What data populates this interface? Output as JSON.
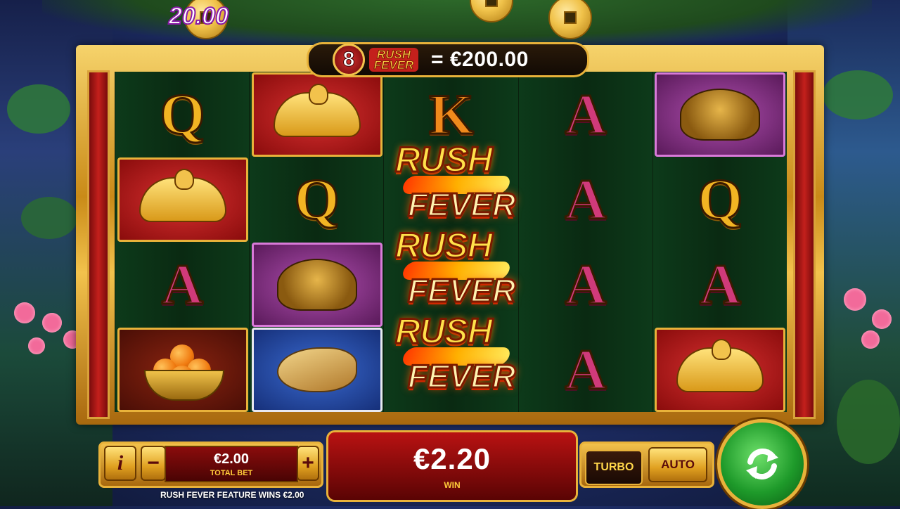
{
  "coin_value": "20.00",
  "top_bar": {
    "multiplier": "8",
    "feature_logo_line1": "RUSH",
    "feature_logo_line2": "FEVER",
    "prize_text": "= €200.00"
  },
  "reels": [
    [
      "Q",
      "bat",
      "A",
      "orange"
    ],
    [
      "bat",
      "Q",
      "frog",
      "bird"
    ],
    [
      "K",
      "rush-fever",
      "rush-fever",
      "rush-fever"
    ],
    [
      "A",
      "A",
      "A",
      "A"
    ],
    [
      "frog",
      "Q",
      "A",
      "bat"
    ]
  ],
  "rush_fever": {
    "word1": "RUSH",
    "word2": "FEVER"
  },
  "controls": {
    "info_label": "i",
    "minus_label": "−",
    "plus_label": "+",
    "total_bet_value": "€2.00",
    "total_bet_label": "TOTAL BET",
    "win_value": "€2.20",
    "win_label": "WIN",
    "turbo_label": "TURBO",
    "auto_label": "AUTO",
    "feature_message": "RUSH FEVER FEATURE WINS €2.00"
  },
  "colors": {
    "gold": "#e8b23a",
    "red_panel": "#b81212",
    "spin_green": "#1e9a2a"
  }
}
